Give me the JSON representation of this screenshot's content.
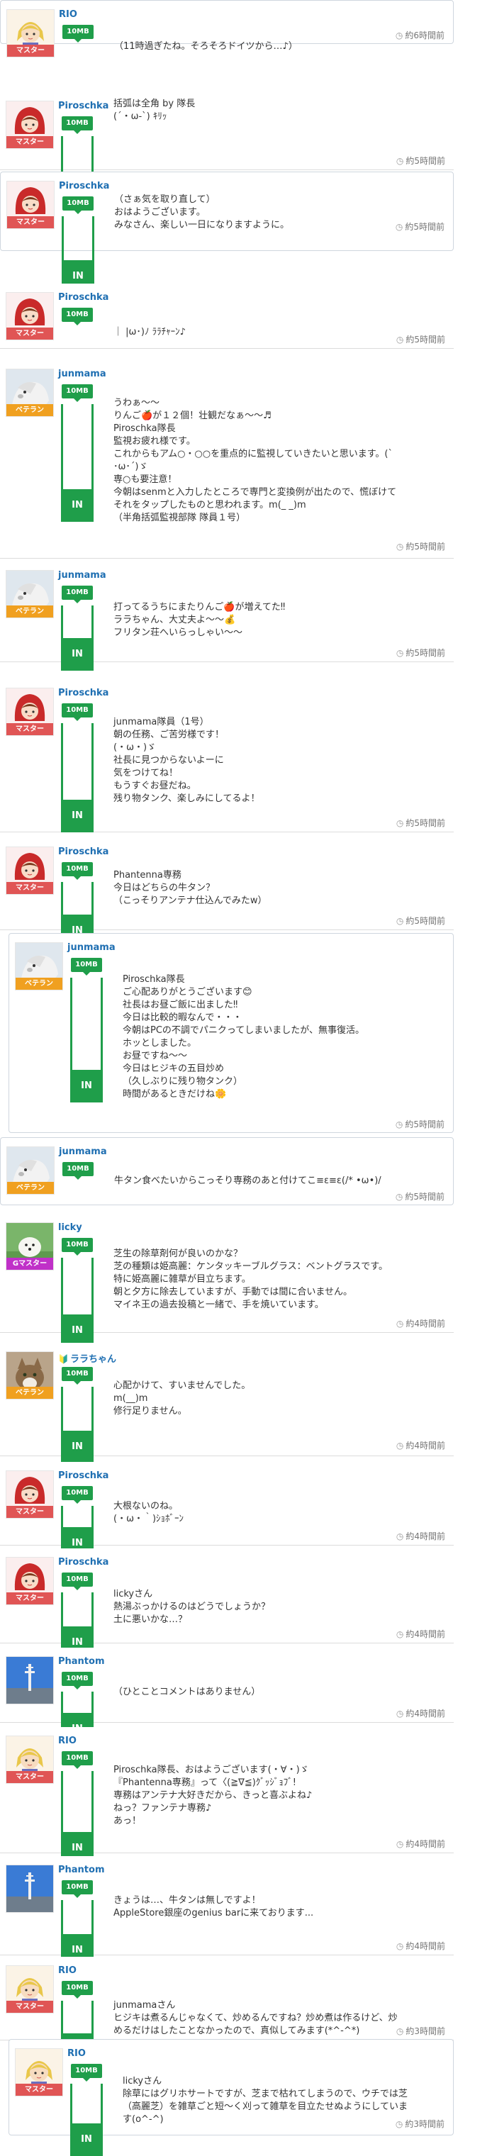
{
  "posts": [
    {
      "id": "p1",
      "user": "RIO",
      "rank": "マスター",
      "storage": "10MB",
      "status": "",
      "message": "（11時過ぎたね。そろそろドイツから…♪）",
      "time": "約6時間前"
    },
    {
      "id": "p2",
      "user": "Piroschka",
      "rank": "マスター",
      "storage": "10MB",
      "status": "IN",
      "message": "括弧は全角 by 隊長\n(´・ω-`) ｷﾘｯ",
      "time": "約5時間前"
    },
    {
      "id": "p3",
      "user": "Piroschka",
      "rank": "マスター",
      "storage": "10MB",
      "status": "IN",
      "message": "（さぁ気を取り直して）\nおはようございます。\nみなさん、楽しい一日になりますように。",
      "time": "約5時間前"
    },
    {
      "id": "p4",
      "user": "Piroschka",
      "rank": "マスター",
      "storage": "10MB",
      "status": "",
      "message": "｜ |ω･)ﾉ ﾗﾗﾁｬｰﾝ♪",
      "time": "約5時間前"
    },
    {
      "id": "p5",
      "user": "junmama",
      "rank": "ベテラン",
      "storage": "10MB",
      "status": "IN",
      "message": "うわぁ〜〜\nりんご🍎が１２個！壮観だなぁ〜〜♬\nPiroschka隊長\n監視お疲れ様です。\nこれからもアム○・○○を重点的に監視していきたいと思います。(`\n･ω･´)ゞ\n専○も要注意！\n今朝はsenmと入力したところで専門と変換例が出たので、慌ぼけて\nそれをタップしたものと思われます。m(_ _)m\n（半角括弧監視部隊 隊員１号）",
      "time": "約5時間前"
    },
    {
      "id": "p6",
      "user": "junmama",
      "rank": "ベテラン",
      "storage": "10MB",
      "status": "IN",
      "message": "打ってるうちにまたりんご🍎が増えてた‼\nララちゃん、大丈夫よ〜〜💰\nフリタン荘へいらっしゃい〜〜",
      "time": "約5時間前"
    },
    {
      "id": "p7",
      "user": "Piroschka",
      "rank": "マスター",
      "storage": "10MB",
      "status": "IN",
      "message": "junmama隊員（1号）\n朝の任務、ご苦労様です！\n(・ω・)ゞ\n社長に見つからないよーに\n気をつけてね！\nもうすぐお昼だね。\n残り物タンク、楽しみにしてるよ！",
      "time": "約5時間前"
    },
    {
      "id": "p8",
      "user": "Piroschka",
      "rank": "マスター",
      "storage": "10MB",
      "status": "IN",
      "message": "Phantenna専務\n今日はどちらの牛タン？\n（こっそりアンテナ仕込んでみたw）",
      "time": "約5時間前"
    },
    {
      "id": "p9",
      "user": "junmama",
      "rank": "ベテラン",
      "storage": "10MB",
      "status": "IN",
      "message": "Piroschka隊長\nご心配ありがとうございます😊\n社長はお昼ご飯に出ました‼\n今日は比較的暇なんで・・・\n今朝はPCの不調でパニクってしまいましたが、無事復活。\nホッとしました。\nお昼ですね〜〜\n今日はヒジキの五目炒め\n（久しぶりに残り物タンク）\n時間があるときだけね🌼",
      "time": "約5時間前"
    },
    {
      "id": "p10",
      "user": "junmama",
      "rank": "ベテラン",
      "storage": "10MB",
      "status": "",
      "message": "牛タン食べたいからこっそり専務のあと付けてこ≡ε≡ε(/* •ω•)/",
      "time": "約5時間前"
    },
    {
      "id": "p11",
      "user": "licky",
      "rank": "Gマスター",
      "storage": "10MB",
      "status": "IN",
      "message": "芝生の除草剤何が良いのかな？\n芝の種類は姫高麗：ケンタッキーブルグラス：ベントグラスです。\n特に姫高麗に雑草が目立ちます。\n朝と夕方に除去していますが、手動では間に合いません。\nマイネ王の過去投稿と一緒で、手を焼いています。",
      "time": "約4時間前"
    },
    {
      "id": "p12",
      "user": "ララちゃん",
      "rank": "ベテラン",
      "storage": "10MB",
      "status": "IN",
      "message": "心配かけて、すいませんでした。\nm(__)m\n修行足りません。",
      "time": "約4時間前"
    },
    {
      "id": "p13",
      "user": "Piroschka",
      "rank": "マスター",
      "storage": "10MB",
      "status": "IN",
      "message": "大根ないのね。\n(・ω・｀)ｼｮﾎﾞｰﾝ",
      "time": "約4時間前"
    },
    {
      "id": "p14",
      "user": "Piroschka",
      "rank": "マスター",
      "storage": "10MB",
      "status": "IN",
      "message": "lickyさん\n熱湯ぶっかけるのはどうでしょうか？\n土に悪いかな…？",
      "time": "約4時間前"
    },
    {
      "id": "p15",
      "user": "Phantom",
      "rank": "",
      "storage": "10MB",
      "status": "IN",
      "message": "（ひとことコメントはありません）",
      "time": "約4時間前"
    },
    {
      "id": "p16",
      "user": "RIO",
      "rank": "マスター",
      "storage": "10MB",
      "status": "IN",
      "message": "Piroschka隊長、おはようございます(・∀・)ゞ\n『Phantenna専務』って〈(≧∇≦)ｸﾞｯｼﾞｮﾌﾞ!\n専務はアンテナ大好きだから、きっと喜ぶよね♪\nねっ？ファンテナ専務♪\nあっ！",
      "time": "約4時間前"
    },
    {
      "id": "p17",
      "user": "Phantom",
      "rank": "",
      "storage": "10MB",
      "status": "IN",
      "message": "きょうは…、牛タンは無しですよ！\nAppleStore銀座のgenius barに来ております...",
      "time": "約4時間前"
    },
    {
      "id": "p18",
      "user": "RIO",
      "rank": "マスター",
      "storage": "10MB",
      "status": "IN",
      "message": "junmamaさん\nヒジキは煮るんじゃなくて、炒めるんですね？炒め煮は作るけど、炒\nめるだけはしたことなかったので、真似してみます(*^-^*)",
      "time": "約3時間前"
    },
    {
      "id": "p19",
      "user": "RIO",
      "rank": "マスター",
      "storage": "10MB",
      "status": "IN",
      "message": "lickyさん\n除草にはグリホサートですが、芝まで枯れてしまうので、ウチでは芝\n（高麗芝）を雑草ごと短〜く刈って雑草を目立たせぬようにしていま\nす(o^-^)",
      "time": "約3時間前"
    }
  ]
}
